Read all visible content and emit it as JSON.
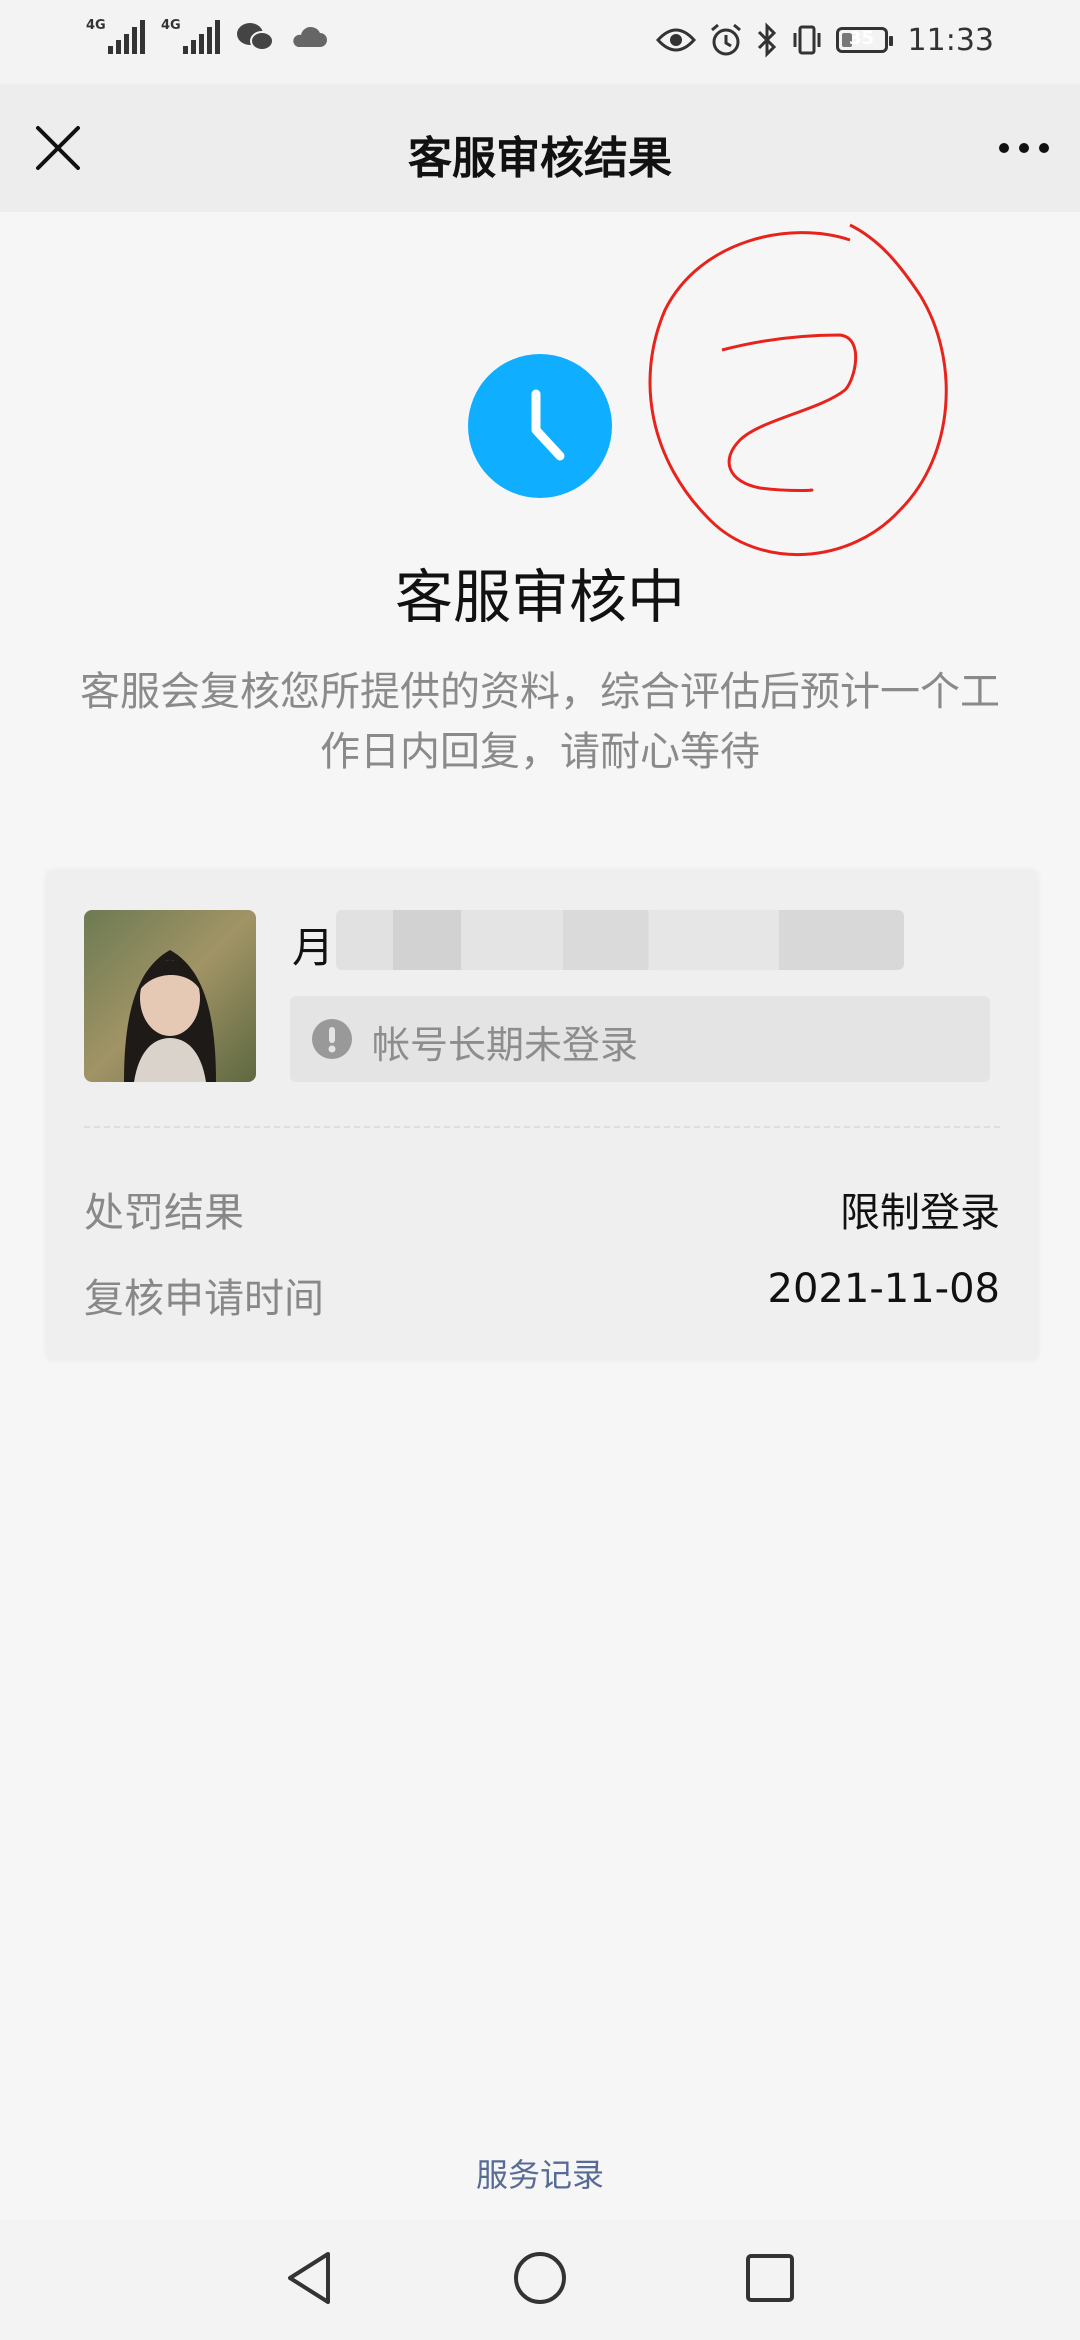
{
  "status_bar": {
    "network_1": "4G",
    "network_2": "4G",
    "battery_level": 35,
    "battery_text": "35",
    "time": "11:33",
    "icons": [
      "signal-icon",
      "signal-icon",
      "wechat-icon",
      "cloud-icon",
      "eye-icon",
      "alarm-icon",
      "bluetooth-icon",
      "vibrate-icon",
      "battery-icon"
    ]
  },
  "header": {
    "title": "客服审核结果",
    "close_icon": "close-icon",
    "more_icon": "more-icon"
  },
  "status": {
    "icon": "clock-icon",
    "icon_color": "#10aeff",
    "title": "客服审核中",
    "description": "客服会复核您所提供的资料，综合评估后预计一个工作日内回复，请耐心等待"
  },
  "annotation": {
    "handwritten_number": "2",
    "color": "#e8231c"
  },
  "account_card": {
    "name_visible": "月",
    "notice_icon": "exclamation-icon",
    "notice_text": "帐号长期未登录",
    "rows": [
      {
        "label": "处罚结果",
        "value": "限制登录"
      },
      {
        "label": "复核申请时间",
        "value": "2021-11-08"
      }
    ]
  },
  "footer": {
    "service_link": "服务记录",
    "link_color": "#576b95"
  },
  "system_nav": {
    "back_icon": "back-triangle-icon",
    "home_icon": "home-circle-icon",
    "recents_icon": "recents-square-icon"
  }
}
